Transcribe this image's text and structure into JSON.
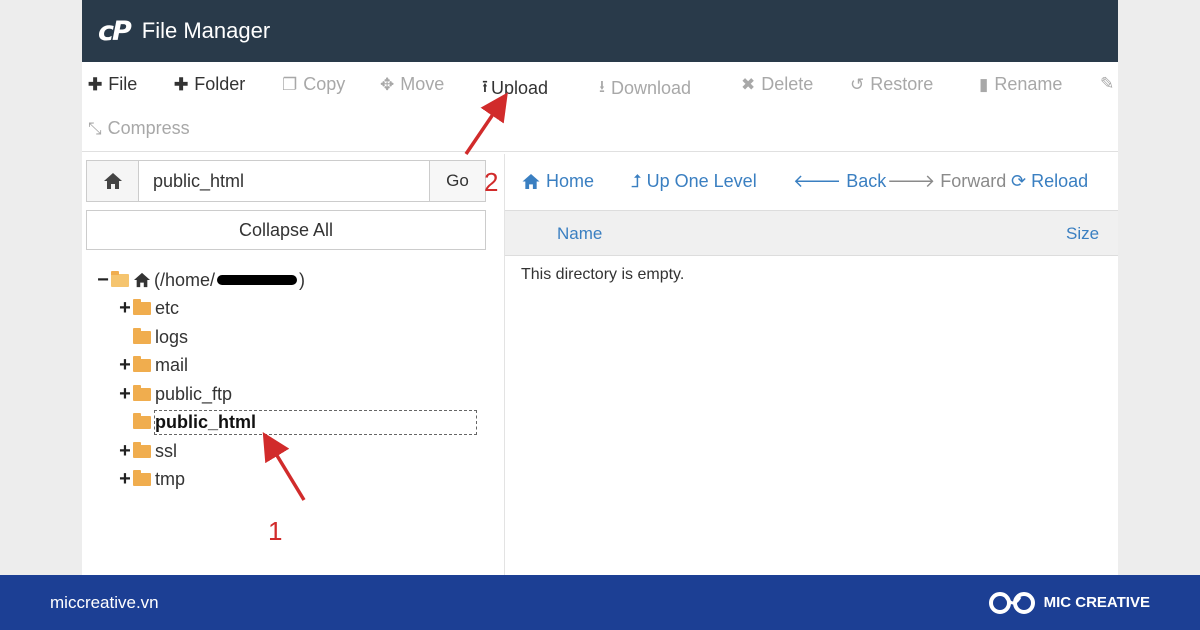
{
  "header": {
    "logo": "cP",
    "title": "File Manager"
  },
  "toolbar": {
    "file": "File",
    "folder": "Folder",
    "copy": "Copy",
    "move": "Move",
    "upload": "Upload",
    "download": "Download",
    "delete": "Delete",
    "restore": "Restore",
    "rename": "Rename",
    "compress": "Compress"
  },
  "address": {
    "path": "public_html",
    "go": "Go"
  },
  "sidebar": {
    "collapse": "Collapse All",
    "root_prefix": "(/home/",
    "root_suffix": ")",
    "folders": [
      {
        "label": "etc",
        "expandable": true
      },
      {
        "label": "logs",
        "expandable": false
      },
      {
        "label": "mail",
        "expandable": true
      },
      {
        "label": "public_ftp",
        "expandable": true
      },
      {
        "label": "public_html",
        "expandable": false,
        "selected": true
      },
      {
        "label": "ssl",
        "expandable": true
      },
      {
        "label": "tmp",
        "expandable": true
      }
    ]
  },
  "nav": {
    "home": "Home",
    "up": "Up One Level",
    "back": "Back",
    "forward": "Forward",
    "reload": "Reload"
  },
  "list": {
    "col_name": "Name",
    "col_size": "Size",
    "empty_msg": "This directory is empty."
  },
  "annotations": {
    "step1": "1",
    "step2": "2"
  },
  "footer": {
    "site": "miccreative.vn",
    "brand": "MIC CREATIVE"
  },
  "colors": {
    "header_bg": "#293a4a",
    "link_blue": "#3a7fc1",
    "folder": "#f0ad4e",
    "annotation_red": "#d12b2b",
    "footer_bg": "#1c3f94"
  }
}
